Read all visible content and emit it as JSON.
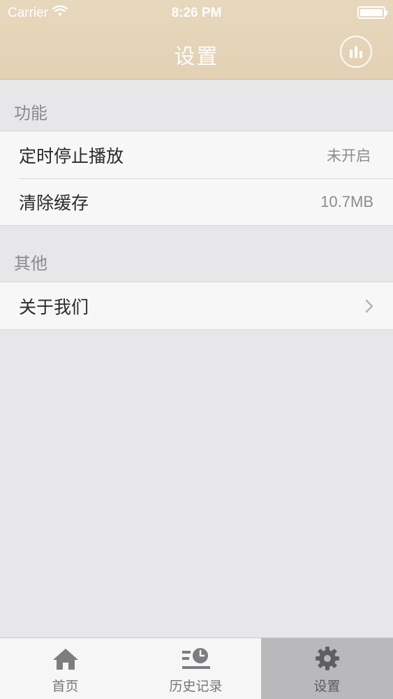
{
  "status_bar": {
    "carrier": "Carrier",
    "time": "8:26 PM"
  },
  "nav": {
    "title": "设置",
    "right_icon": "bar-chart-icon"
  },
  "sections": [
    {
      "header": "功能",
      "items": [
        {
          "label": "定时停止播放",
          "value": "未开启"
        },
        {
          "label": "清除缓存",
          "value": "10.7MB"
        }
      ]
    },
    {
      "header": "其他",
      "items": [
        {
          "label": "关于我们",
          "accessory": "chevron-right-icon"
        }
      ]
    }
  ],
  "tab_bar": {
    "tabs": [
      {
        "label": "首页",
        "icon": "home-icon",
        "selected": false
      },
      {
        "label": "历史记录",
        "icon": "history-icon",
        "selected": false
      },
      {
        "label": "设置",
        "icon": "gear-icon",
        "selected": true
      }
    ]
  },
  "colors": {
    "nav_background": "#e5d5b8",
    "page_background": "#e7e6e9",
    "cell_background": "#f7f7f8",
    "tab_selected_background": "#b9b8bb"
  }
}
